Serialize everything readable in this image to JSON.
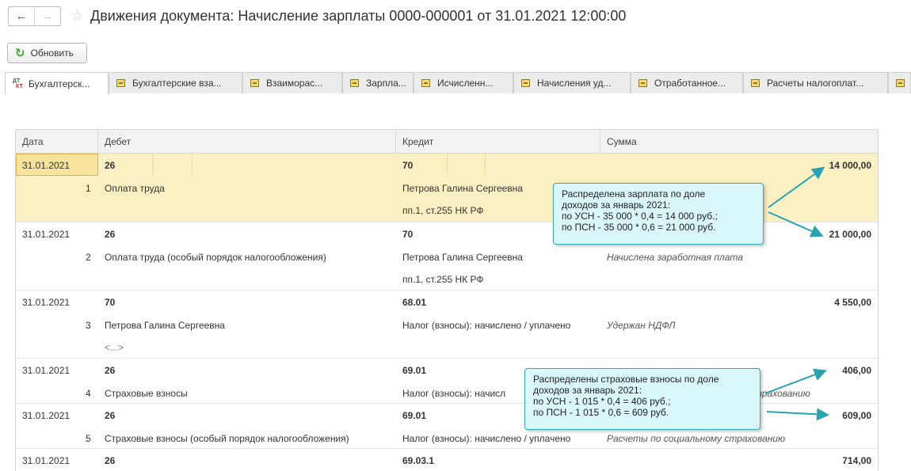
{
  "window": {
    "title": "Движения документа: Начисление зарплаты 0000-000001 от 31.01.2021 12:00:00",
    "back_icon": "←",
    "forward_icon": "→",
    "favorite_icon": "☆"
  },
  "toolbar": {
    "refresh_label": "Обновить",
    "refresh_icon": "↻"
  },
  "tabs": [
    {
      "label": "Бухгалтерск...",
      "icon": "dt-kt-icon",
      "active": true
    },
    {
      "label": "Бухгалтерские вза...",
      "icon": "register-icon"
    },
    {
      "label": "Взаиморас...",
      "icon": "register-icon"
    },
    {
      "label": "Зарпла...",
      "icon": "register-icon"
    },
    {
      "label": "Исчисленн...",
      "icon": "register-icon"
    },
    {
      "label": "Начисления уд...",
      "icon": "register-icon"
    },
    {
      "label": "Отработанное...",
      "icon": "register-icon"
    },
    {
      "label": "Расчеты налогоплат...",
      "icon": "register-icon"
    }
  ],
  "table": {
    "columns": [
      "Дата",
      "Дебет",
      "Кредит",
      "Сумма"
    ],
    "rows": [
      {
        "date": "31.01.2021",
        "n": "1",
        "debit": "26",
        "debit_sub": "Оплата труда",
        "credit": "70",
        "credit_sub": "Петрова Галина Сергеевна",
        "credit_sub2": "пп.1, ст.255 НК РФ",
        "amount": "14 000,00",
        "content": ""
      },
      {
        "date": "31.01.2021",
        "n": "2",
        "debit": "26",
        "debit_sub": "Оплата труда (особый порядок налогообложения)",
        "credit": "70",
        "credit_sub": "Петрова Галина Сергеевна",
        "credit_sub2": "пп.1, ст.255 НК РФ",
        "amount": "21 000,00",
        "content": "Начислена заработная плата"
      },
      {
        "date": "31.01.2021",
        "n": "3",
        "debit": "70",
        "debit_sub": "Петрова Галина Сергеевна",
        "debit_sub2": "<...>",
        "credit": "68.01",
        "credit_sub": "Налог (взносы): начислено / уплачено",
        "amount": "4 550,00",
        "content": "Удержан НДФЛ"
      },
      {
        "date": "31.01.2021",
        "n": "4",
        "debit": "26",
        "debit_sub": "Страховые взносы",
        "credit": "69.01",
        "credit_sub": "Налог (взносы): начисл",
        "amount": "406,00",
        "content": "страхованию"
      },
      {
        "date": "31.01.2021",
        "n": "5",
        "debit": "26",
        "debit_sub": "Страховые взносы (особый порядок налогообложения)",
        "credit": "69.01",
        "credit_sub": "Налог (взносы): начислено / уплачено",
        "amount": "609,00",
        "content": "Расчеты по социальному страхованию"
      },
      {
        "date": "31.01.2021",
        "debit": "26",
        "credit": "69.03.1",
        "amount": "714,00"
      }
    ]
  },
  "callouts": [
    {
      "lines": [
        "Распределена зарплата по доле",
        "доходов за январь 2021:",
        "по УСН - 35 000 * 0,4 = 14 000 руб.;",
        "по ПСН - 35 000 * 0,6 = 21 000 руб."
      ]
    },
    {
      "lines": [
        "Распределены страховые взносы по доле",
        "доходов за январь 2021:",
        "по УСН - 1 015 * 0,4 = 406 руб.;",
        "по ПСН - 1 015 * 0,6 = 609 руб."
      ]
    }
  ],
  "colors": {
    "selected_row": "#fbf0c3",
    "callout_bg": "#d9f6f8",
    "arrow": "#2aa3b0"
  }
}
